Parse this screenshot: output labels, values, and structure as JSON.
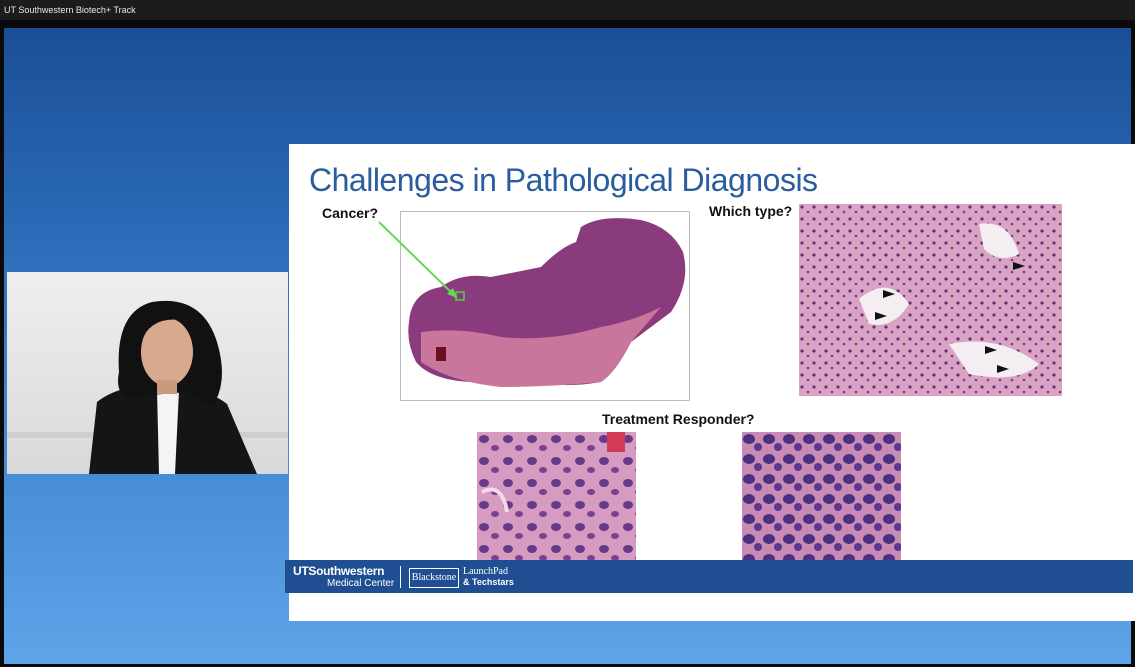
{
  "window": {
    "title": "UT Southwestern Biotech+ Track"
  },
  "slide": {
    "title": "Challenges in Pathological Diagnosis",
    "label_cancer": "Cancer?",
    "label_type": "Which type?",
    "label_responder": "Treatment Responder?"
  },
  "footer": {
    "ut_name": "UTSouthwestern",
    "ut_sub": "Medical Center",
    "blackstone": "Blackstone",
    "launchpad": "LaunchPad",
    "techstars": "& Techstars"
  },
  "colors": {
    "title_blue": "#2a5d9f",
    "footer_blue": "#1f4f92",
    "tissue_purple": "#8a3b7d",
    "tissue_pink": "#c9769d"
  }
}
